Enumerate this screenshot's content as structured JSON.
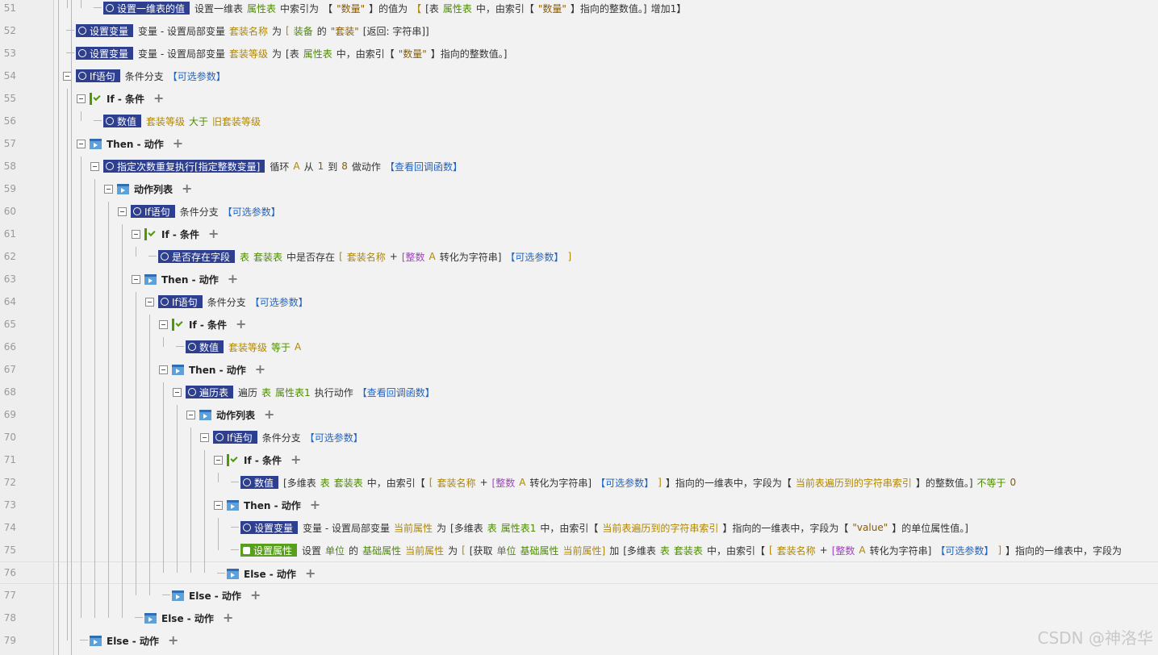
{
  "watermark": "CSDN @神洛华",
  "icons": {
    "call": "function-call-icon",
    "condition": "condition-check-icon",
    "action": "action-list-icon",
    "collapse": "collapse-toggle-icon",
    "add": "add-plus-icon",
    "setprop": "unit-property-icon"
  },
  "rows": [
    {
      "num": "51",
      "depth": 2,
      "toggle": false,
      "icon": "",
      "chip": "设置一维表的值",
      "chip_color": "navy",
      "segs": [
        {
          "t": "设置一维表",
          "c": "dark"
        },
        {
          "t": "属性表",
          "c": "green"
        },
        {
          "t": "中索引为",
          "c": "dark"
        },
        {
          "t": "【",
          "c": "dark"
        },
        {
          "t": "\"数量\"",
          "c": "str"
        },
        {
          "t": "】的值为",
          "c": "dark"
        },
        {
          "t": "【",
          "c": "gold"
        },
        {
          "t": "[表",
          "c": "dark"
        },
        {
          "t": "属性表",
          "c": "green"
        },
        {
          "t": "中，由索引【",
          "c": "dark"
        },
        {
          "t": "\"数量\"",
          "c": "str"
        },
        {
          "t": "】指向的整数值。]",
          "c": "dark"
        },
        {
          "t": "增加1】",
          "c": "dark"
        }
      ]
    },
    {
      "num": "52",
      "depth": 0,
      "toggle": false,
      "icon": "",
      "chip": "设置变量",
      "chip_color": "navy",
      "segs": [
        {
          "t": "变量 - 设置局部变量",
          "c": "dark"
        },
        {
          "t": "套装名称",
          "c": "gold"
        },
        {
          "t": "为",
          "c": "dark"
        },
        {
          "t": "[",
          "c": "gold"
        },
        {
          "t": "装备",
          "c": "green"
        },
        {
          "t": "的",
          "c": "dark"
        },
        {
          "t": "\"套装\"",
          "c": "str"
        },
        {
          "t": "[返回: 字符串]]",
          "c": "dark"
        }
      ]
    },
    {
      "num": "53",
      "depth": 0,
      "toggle": false,
      "icon": "",
      "chip": "设置变量",
      "chip_color": "navy",
      "segs": [
        {
          "t": "变量 - 设置局部变量",
          "c": "dark"
        },
        {
          "t": "套装等级",
          "c": "gold"
        },
        {
          "t": "为",
          "c": "dark"
        },
        {
          "t": "[表",
          "c": "dark"
        },
        {
          "t": "属性表",
          "c": "green"
        },
        {
          "t": "中，由索引【",
          "c": "dark"
        },
        {
          "t": "\"数量\"",
          "c": "str"
        },
        {
          "t": "】指向的整数值。]",
          "c": "dark"
        }
      ]
    },
    {
      "num": "54",
      "depth": 0,
      "toggle": true,
      "icon": "",
      "chip": "If语句",
      "chip_color": "navy",
      "segs": [
        {
          "t": "条件分支",
          "c": "dark"
        },
        {
          "t": "【可选参数】",
          "c": "blue"
        }
      ]
    },
    {
      "num": "55",
      "depth": 1,
      "toggle": true,
      "icon": "cond",
      "label": "If - 条件",
      "plus": true,
      "segs": []
    },
    {
      "num": "56",
      "depth": 2,
      "toggle": false,
      "icon": "",
      "chip": "数值",
      "chip_color": "navy",
      "segs": [
        {
          "t": "套装等级",
          "c": "gold"
        },
        {
          "t": "大于",
          "c": "green"
        },
        {
          "t": "旧套装等级",
          "c": "gold"
        }
      ]
    },
    {
      "num": "57",
      "depth": 1,
      "toggle": true,
      "icon": "act",
      "label": "Then - 动作",
      "plus": true,
      "segs": []
    },
    {
      "num": "58",
      "depth": 2,
      "toggle": true,
      "icon": "",
      "chip": "指定次数重复执行[指定整数变量]",
      "chip_color": "navy",
      "segs": [
        {
          "t": "循环",
          "c": "dark"
        },
        {
          "t": "A",
          "c": "gold"
        },
        {
          "t": "从",
          "c": "dark"
        },
        {
          "t": "1",
          "c": "str"
        },
        {
          "t": "到",
          "c": "dark"
        },
        {
          "t": "8",
          "c": "str"
        },
        {
          "t": "做动作",
          "c": "dark"
        },
        {
          "t": "【查看回调函数】",
          "c": "blue"
        }
      ]
    },
    {
      "num": "59",
      "depth": 3,
      "toggle": true,
      "icon": "act",
      "label": "动作列表",
      "plus": true,
      "segs": []
    },
    {
      "num": "60",
      "depth": 4,
      "toggle": true,
      "icon": "",
      "chip": "If语句",
      "chip_color": "navy",
      "segs": [
        {
          "t": "条件分支",
          "c": "dark"
        },
        {
          "t": "【可选参数】",
          "c": "blue"
        }
      ]
    },
    {
      "num": "61",
      "depth": 5,
      "toggle": true,
      "icon": "cond",
      "label": "If - 条件",
      "plus": true,
      "segs": []
    },
    {
      "num": "62",
      "depth": 6,
      "toggle": false,
      "icon": "",
      "chip": "是否存在字段",
      "chip_color": "navy",
      "segs": [
        {
          "t": "表",
          "c": "green"
        },
        {
          "t": "套装表",
          "c": "green"
        },
        {
          "t": "中是否存在",
          "c": "dark"
        },
        {
          "t": "[",
          "c": "gold"
        },
        {
          "t": "套装名称",
          "c": "gold"
        },
        {
          "t": "+",
          "c": "dark"
        },
        {
          "t": "[整数",
          "c": "purple"
        },
        {
          "t": "A",
          "c": "gold"
        },
        {
          "t": "转化为字符串]",
          "c": "dark"
        },
        {
          "t": "【可选参数】",
          "c": "blue"
        },
        {
          "t": "]",
          "c": "gold"
        }
      ]
    },
    {
      "num": "63",
      "depth": 5,
      "toggle": true,
      "icon": "act",
      "label": "Then - 动作",
      "plus": true,
      "segs": []
    },
    {
      "num": "64",
      "depth": 6,
      "toggle": true,
      "icon": "",
      "chip": "If语句",
      "chip_color": "navy",
      "segs": [
        {
          "t": "条件分支",
          "c": "dark"
        },
        {
          "t": "【可选参数】",
          "c": "blue"
        }
      ]
    },
    {
      "num": "65",
      "depth": 7,
      "toggle": true,
      "icon": "cond",
      "label": "If - 条件",
      "plus": true,
      "segs": []
    },
    {
      "num": "66",
      "depth": 8,
      "toggle": false,
      "icon": "",
      "chip": "数值",
      "chip_color": "navy",
      "segs": [
        {
          "t": "套装等级",
          "c": "gold"
        },
        {
          "t": "等于",
          "c": "green"
        },
        {
          "t": "A",
          "c": "gold"
        }
      ]
    },
    {
      "num": "67",
      "depth": 7,
      "toggle": true,
      "icon": "act",
      "label": "Then - 动作",
      "plus": true,
      "segs": []
    },
    {
      "num": "68",
      "depth": 8,
      "toggle": true,
      "icon": "",
      "chip": "遍历表",
      "chip_color": "navy",
      "segs": [
        {
          "t": "遍历",
          "c": "dark"
        },
        {
          "t": "表",
          "c": "green"
        },
        {
          "t": "属性表1",
          "c": "green"
        },
        {
          "t": "执行动作",
          "c": "dark"
        },
        {
          "t": "【查看回调函数】",
          "c": "blue"
        }
      ]
    },
    {
      "num": "69",
      "depth": 9,
      "toggle": true,
      "icon": "act",
      "label": "动作列表",
      "plus": true,
      "segs": []
    },
    {
      "num": "70",
      "depth": 10,
      "toggle": true,
      "icon": "",
      "chip": "If语句",
      "chip_color": "navy",
      "segs": [
        {
          "t": "条件分支",
          "c": "dark"
        },
        {
          "t": "【可选参数】",
          "c": "blue"
        }
      ]
    },
    {
      "num": "71",
      "depth": 11,
      "toggle": true,
      "icon": "cond",
      "label": "If - 条件",
      "plus": true,
      "segs": []
    },
    {
      "num": "72",
      "depth": 12,
      "toggle": false,
      "icon": "",
      "chip": "数值",
      "chip_color": "navy",
      "segs": [
        {
          "t": "[多维表",
          "c": "dark"
        },
        {
          "t": "表",
          "c": "green"
        },
        {
          "t": "套装表",
          "c": "green"
        },
        {
          "t": "中，由索引【",
          "c": "dark"
        },
        {
          "t": "[",
          "c": "gold"
        },
        {
          "t": "套装名称",
          "c": "gold"
        },
        {
          "t": "+",
          "c": "dark"
        },
        {
          "t": "[整数",
          "c": "purple"
        },
        {
          "t": "A",
          "c": "gold"
        },
        {
          "t": "转化为字符串]",
          "c": "dark"
        },
        {
          "t": "【可选参数】",
          "c": "blue"
        },
        {
          "t": "]",
          "c": "gold"
        },
        {
          "t": "】指向的一维表中，字段为【",
          "c": "dark"
        },
        {
          "t": "当前表遍历到的字符串索引",
          "c": "gold"
        },
        {
          "t": "】的整数值。]",
          "c": "dark"
        },
        {
          "t": "不等于",
          "c": "green"
        },
        {
          "t": "0",
          "c": "str"
        }
      ]
    },
    {
      "num": "73",
      "depth": 11,
      "toggle": true,
      "icon": "act",
      "label": "Then - 动作",
      "plus": true,
      "segs": []
    },
    {
      "num": "74",
      "depth": 12,
      "toggle": false,
      "icon": "",
      "chip": "设置变量",
      "chip_color": "navy",
      "segs": [
        {
          "t": "变量 - 设置局部变量",
          "c": "dark"
        },
        {
          "t": "当前属性",
          "c": "gold"
        },
        {
          "t": "为",
          "c": "dark"
        },
        {
          "t": "[多维表",
          "c": "dark"
        },
        {
          "t": "表",
          "c": "green"
        },
        {
          "t": "属性表1",
          "c": "green"
        },
        {
          "t": "中，由索引【",
          "c": "dark"
        },
        {
          "t": "当前表遍历到的字符串索引",
          "c": "gold"
        },
        {
          "t": "】指向的一维表中，字段为【",
          "c": "dark"
        },
        {
          "t": "\"value\"",
          "c": "str"
        },
        {
          "t": "】的单位属性值。]",
          "c": "dark"
        }
      ]
    },
    {
      "num": "75",
      "depth": 12,
      "toggle": false,
      "icon": "",
      "chip": "设置属性",
      "chip_color": "green",
      "segs": [
        {
          "t": "设置",
          "c": "dark"
        },
        {
          "t": "单位",
          "c": "green"
        },
        {
          "t": "的",
          "c": "dark"
        },
        {
          "t": "基础属性",
          "c": "green"
        },
        {
          "t": "当前属性",
          "c": "gold"
        },
        {
          "t": "为",
          "c": "dark"
        },
        {
          "t": "[",
          "c": "gold"
        },
        {
          "t": "[获取",
          "c": "dark"
        },
        {
          "t": "单位",
          "c": "green"
        },
        {
          "t": "基础属性",
          "c": "green"
        },
        {
          "t": "当前属性]",
          "c": "gold"
        },
        {
          "t": "加",
          "c": "dark"
        },
        {
          "t": "[多维表",
          "c": "dark"
        },
        {
          "t": "表",
          "c": "green"
        },
        {
          "t": "套装表",
          "c": "green"
        },
        {
          "t": "中，由索引【",
          "c": "dark"
        },
        {
          "t": "[",
          "c": "gold"
        },
        {
          "t": "套装名称",
          "c": "gold"
        },
        {
          "t": "+",
          "c": "dark"
        },
        {
          "t": "[整数",
          "c": "purple"
        },
        {
          "t": "A",
          "c": "gold"
        },
        {
          "t": "转化为字符串]",
          "c": "dark"
        },
        {
          "t": "【可选参数】",
          "c": "blue"
        },
        {
          "t": "]",
          "c": "gold"
        },
        {
          "t": "】指向的一维表中，字段为",
          "c": "dark"
        }
      ]
    },
    {
      "num": "76",
      "depth": 11,
      "toggle": false,
      "icon": "act",
      "label": "Else - 动作",
      "plus": true,
      "segs": [],
      "hl": true
    },
    {
      "num": "77",
      "depth": 7,
      "toggle": false,
      "icon": "act",
      "label": "Else - 动作",
      "plus": true,
      "segs": []
    },
    {
      "num": "78",
      "depth": 5,
      "toggle": false,
      "icon": "act",
      "label": "Else - 动作",
      "plus": true,
      "segs": []
    },
    {
      "num": "79",
      "depth": 1,
      "toggle": false,
      "icon": "act",
      "label": "Else - 动作",
      "plus": true,
      "segs": []
    }
  ]
}
